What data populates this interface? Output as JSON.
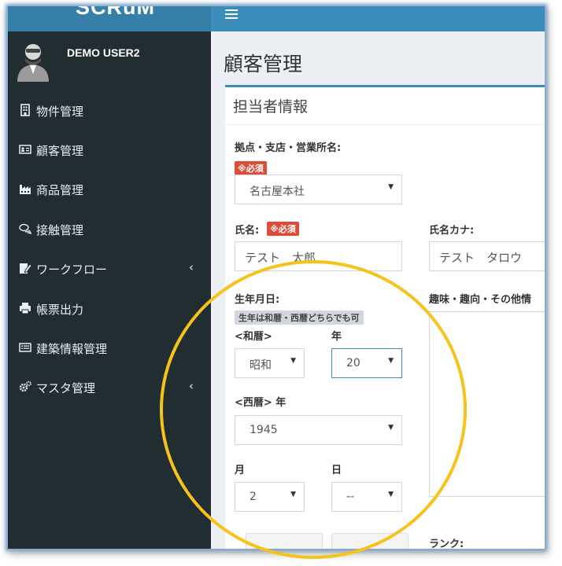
{
  "app": {
    "logo": "SCRuM"
  },
  "user": {
    "name": "DEMO USER2"
  },
  "sidebar": {
    "items": [
      {
        "label": "物件管理",
        "icon": "building-icon"
      },
      {
        "label": "顧客管理",
        "icon": "id-card-icon"
      },
      {
        "label": "商品管理",
        "icon": "industry-icon"
      },
      {
        "label": "接触管理",
        "icon": "comments-icon"
      },
      {
        "label": "ワークフロー",
        "icon": "edit-icon",
        "has_submenu": true
      },
      {
        "label": "帳票出力",
        "icon": "print-icon"
      },
      {
        "label": "建築情報管理",
        "icon": "list-card-icon"
      },
      {
        "label": "マスタ管理",
        "icon": "cogs-icon",
        "has_submenu": true
      }
    ],
    "chevron": "‹"
  },
  "page": {
    "title": "顧客管理"
  },
  "section": {
    "title": "担当者情報"
  },
  "form": {
    "branch": {
      "label": "拠点・支店・営業所名:",
      "required": "※必須",
      "value": "名古屋本社"
    },
    "name": {
      "label": "氏名:",
      "required": "※必須",
      "value": "テスト　太郎"
    },
    "name_kana": {
      "label": "氏名カナ:",
      "value": "テスト　タロウ"
    },
    "birthdate": {
      "label": "生年月日:",
      "note": "生年は和暦・西暦どちらでも可"
    },
    "wareki": {
      "label": "<和暦>",
      "era": "昭和"
    },
    "wareki_year": {
      "label": "年",
      "value": "20"
    },
    "seireki": {
      "label": "<西暦> 年",
      "value": "1945"
    },
    "month": {
      "label": "月",
      "value": "2"
    },
    "day": {
      "label": "日",
      "value": "--"
    },
    "hobby": {
      "label": "趣味・趣向・その他情"
    },
    "rank": {
      "label": "ランク:"
    }
  },
  "colors": {
    "sidebar": "#222d32",
    "header": "#3c8dbc",
    "required": "#dd4b39",
    "highlight": "#f7c21c"
  }
}
